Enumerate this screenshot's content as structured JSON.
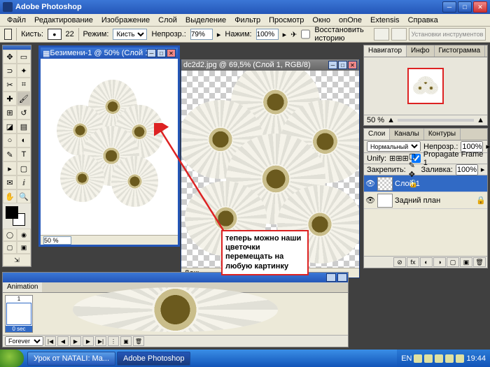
{
  "titlebar": {
    "title": "Adobe Photoshop"
  },
  "menu": [
    "Файл",
    "Редактирование",
    "Изображение",
    "Слой",
    "Выделение",
    "Фильтр",
    "Просмотр",
    "Окно",
    "onOne",
    "Extensis",
    "Справка"
  ],
  "options": {
    "brush_lbl": "Кисть:",
    "brush_size": "22",
    "mode_lbl": "Режим:",
    "mode_val": "Кисть",
    "opacity_lbl": "Непрозр.:",
    "opacity_val": "79%",
    "flow_lbl": "Нажим:",
    "flow_val": "100%",
    "history_lbl": "Восстановить историю",
    "installer": "Установки инструментов"
  },
  "doc1": {
    "title": "Безимени-1 @ 50% (Слой 1,...",
    "zoom": "50 %"
  },
  "doc2": {
    "title": "dc2d2.jpg @ 69,5% (Слой 1, RGB/8)",
    "status": "Док:"
  },
  "nav": {
    "tabs": [
      "Навигатор",
      "Инфо",
      "Гистограмма"
    ],
    "zoom": "50 %"
  },
  "layers": {
    "tabs": [
      "Слои",
      "Каналы",
      "Контуры"
    ],
    "mode": "Нормальный",
    "opacity_lbl": "Непрозр.:",
    "opacity_val": "100%",
    "unify_lbl": "Unify:",
    "propagate": "Propagate Frame 1",
    "lock_lbl": "Закрепить:",
    "fill_lbl": "Заливка:",
    "fill_val": "100%",
    "rows": [
      {
        "name": "Слой 1",
        "sel": true,
        "trans": true
      },
      {
        "name": "Задний план",
        "sel": false,
        "trans": false,
        "locked": true
      }
    ]
  },
  "anim": {
    "tab": "Animation",
    "frame_num": "1",
    "frame_time": "0 sec",
    "loop": "Forever"
  },
  "annotation": "теперь можно наши цветочки перемещать на любую картинку",
  "taskbar": {
    "items": [
      {
        "label": "Урок от NATALI: Ma...",
        "active": false
      },
      {
        "label": "Adobe Photoshop",
        "active": true
      }
    ],
    "lang": "EN",
    "time": "19:44"
  }
}
